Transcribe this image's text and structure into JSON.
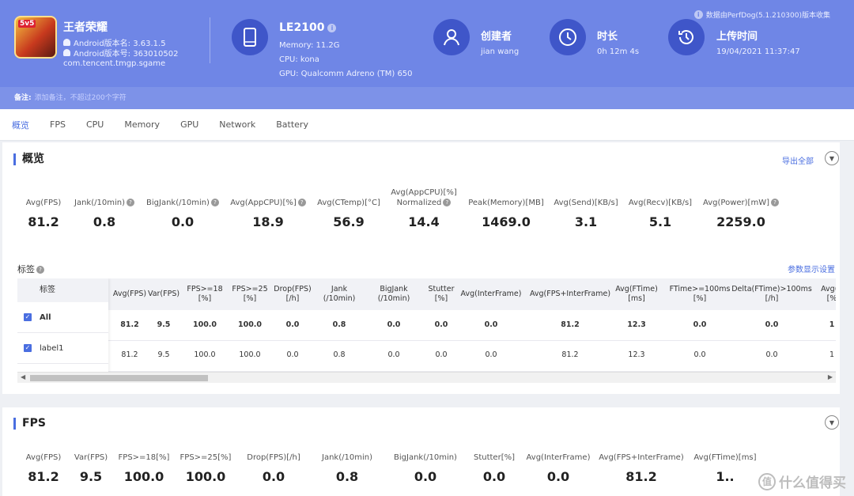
{
  "app": {
    "icon_badge": "5v5",
    "name": "王者荣耀",
    "version_name": "Android版本名: 3.63.1.5",
    "version_code": "Android版本号: 363010502",
    "package": "com.tencent.tmgp.sgame"
  },
  "device": {
    "name": "LE2100",
    "memory": "Memory: 11.2G",
    "cpu": "CPU: kona",
    "gpu": "GPU: Qualcomm Adreno (TM) 650"
  },
  "creator": {
    "title": "创建者",
    "value": "jian wang"
  },
  "duration": {
    "title": "时长",
    "value": "0h 12m 4s"
  },
  "upload": {
    "title": "上传时间",
    "value": "19/04/2021 11:37:47"
  },
  "source_note": "数据由PerfDog(5.1.210300)版本收集",
  "remark": {
    "label": "备注:",
    "placeholder": "添加备注，不超过200个字符"
  },
  "tabs": [
    "概览",
    "FPS",
    "CPU",
    "Memory",
    "GPU",
    "Network",
    "Battery"
  ],
  "overview": {
    "title": "概览",
    "export": "导出全部",
    "stats": [
      {
        "label": "Avg(FPS)",
        "value": "81.2",
        "help": false
      },
      {
        "label": "Jank(/10min)",
        "value": "0.8",
        "help": true
      },
      {
        "label": "BigJank(/10min)",
        "value": "0.0",
        "help": true
      },
      {
        "label": "Avg(AppCPU)[%]",
        "value": "18.9",
        "help": true
      },
      {
        "label": "Avg(CTemp)[°C]",
        "value": "56.9",
        "help": false
      },
      {
        "label": "Avg(AppCPU)[%]",
        "label2": "Normalized",
        "value": "14.4",
        "help": true
      },
      {
        "label": "Peak(Memory)[MB]",
        "value": "1469.0",
        "help": false
      },
      {
        "label": "Avg(Send)[KB/s]",
        "value": "3.1",
        "help": false
      },
      {
        "label": "Avg(Recv)[KB/s]",
        "value": "5.1",
        "help": false
      },
      {
        "label": "Avg(Power)[mW]",
        "value": "2259.0",
        "help": true
      }
    ],
    "tags_title": "标签",
    "param_settings": "参数显示设置",
    "table": {
      "tag_header": "标签",
      "columns": [
        {
          "l1": "Avg(FPS)",
          "l2": ""
        },
        {
          "l1": "Var(FPS)",
          "l2": ""
        },
        {
          "l1": "FPS>=18",
          "l2": "[%]"
        },
        {
          "l1": "FPS>=25",
          "l2": "[%]"
        },
        {
          "l1": "Drop(FPS)",
          "l2": "[/h]"
        },
        {
          "l1": "Jank",
          "l2": "(/10min)"
        },
        {
          "l1": "BigJank",
          "l2": "(/10min)"
        },
        {
          "l1": "Stutter",
          "l2": "[%]"
        },
        {
          "l1": "Avg(InterFrame)",
          "l2": ""
        },
        {
          "l1": "Avg(FPS+InterFrame)",
          "l2": ""
        },
        {
          "l1": "Avg(FTime)",
          "l2": "[ms]"
        },
        {
          "l1": "FTime>=100ms",
          "l2": "[%]"
        },
        {
          "l1": "Delta(FTime)>100ms",
          "l2": "[/h]"
        },
        {
          "l1": "Avg(A",
          "l2": "[%"
        }
      ],
      "rows": [
        {
          "tag": "All",
          "values": [
            "81.2",
            "9.5",
            "100.0",
            "100.0",
            "0.0",
            "0.8",
            "0.0",
            "0.0",
            "0.0",
            "81.2",
            "12.3",
            "0.0",
            "0.0",
            "1"
          ]
        },
        {
          "tag": "label1",
          "values": [
            "81.2",
            "9.5",
            "100.0",
            "100.0",
            "0.0",
            "0.8",
            "0.0",
            "0.0",
            "0.0",
            "81.2",
            "12.3",
            "0.0",
            "0.0",
            "1"
          ]
        }
      ]
    }
  },
  "fps": {
    "title": "FPS",
    "stats": [
      {
        "label": "Avg(FPS)",
        "value": "81.2"
      },
      {
        "label": "Var(FPS)",
        "value": "9.5"
      },
      {
        "label": "FPS>=18[%]",
        "value": "100.0"
      },
      {
        "label": "FPS>=25[%]",
        "value": "100.0"
      },
      {
        "label": "Drop(FPS)[/h]",
        "value": "0.0"
      },
      {
        "label": "Jank(/10min)",
        "value": "0.8"
      },
      {
        "label": "BigJank(/10min)",
        "value": "0.0"
      },
      {
        "label": "Stutter[%]",
        "value": "0.0"
      },
      {
        "label": "Avg(InterFrame)",
        "value": "0.0"
      },
      {
        "label": "Avg(FPS+InterFrame)",
        "value": "81.2"
      },
      {
        "label": "Avg(FTime)[ms]",
        "value": "1.."
      }
    ]
  },
  "watermark": "什么值得买"
}
